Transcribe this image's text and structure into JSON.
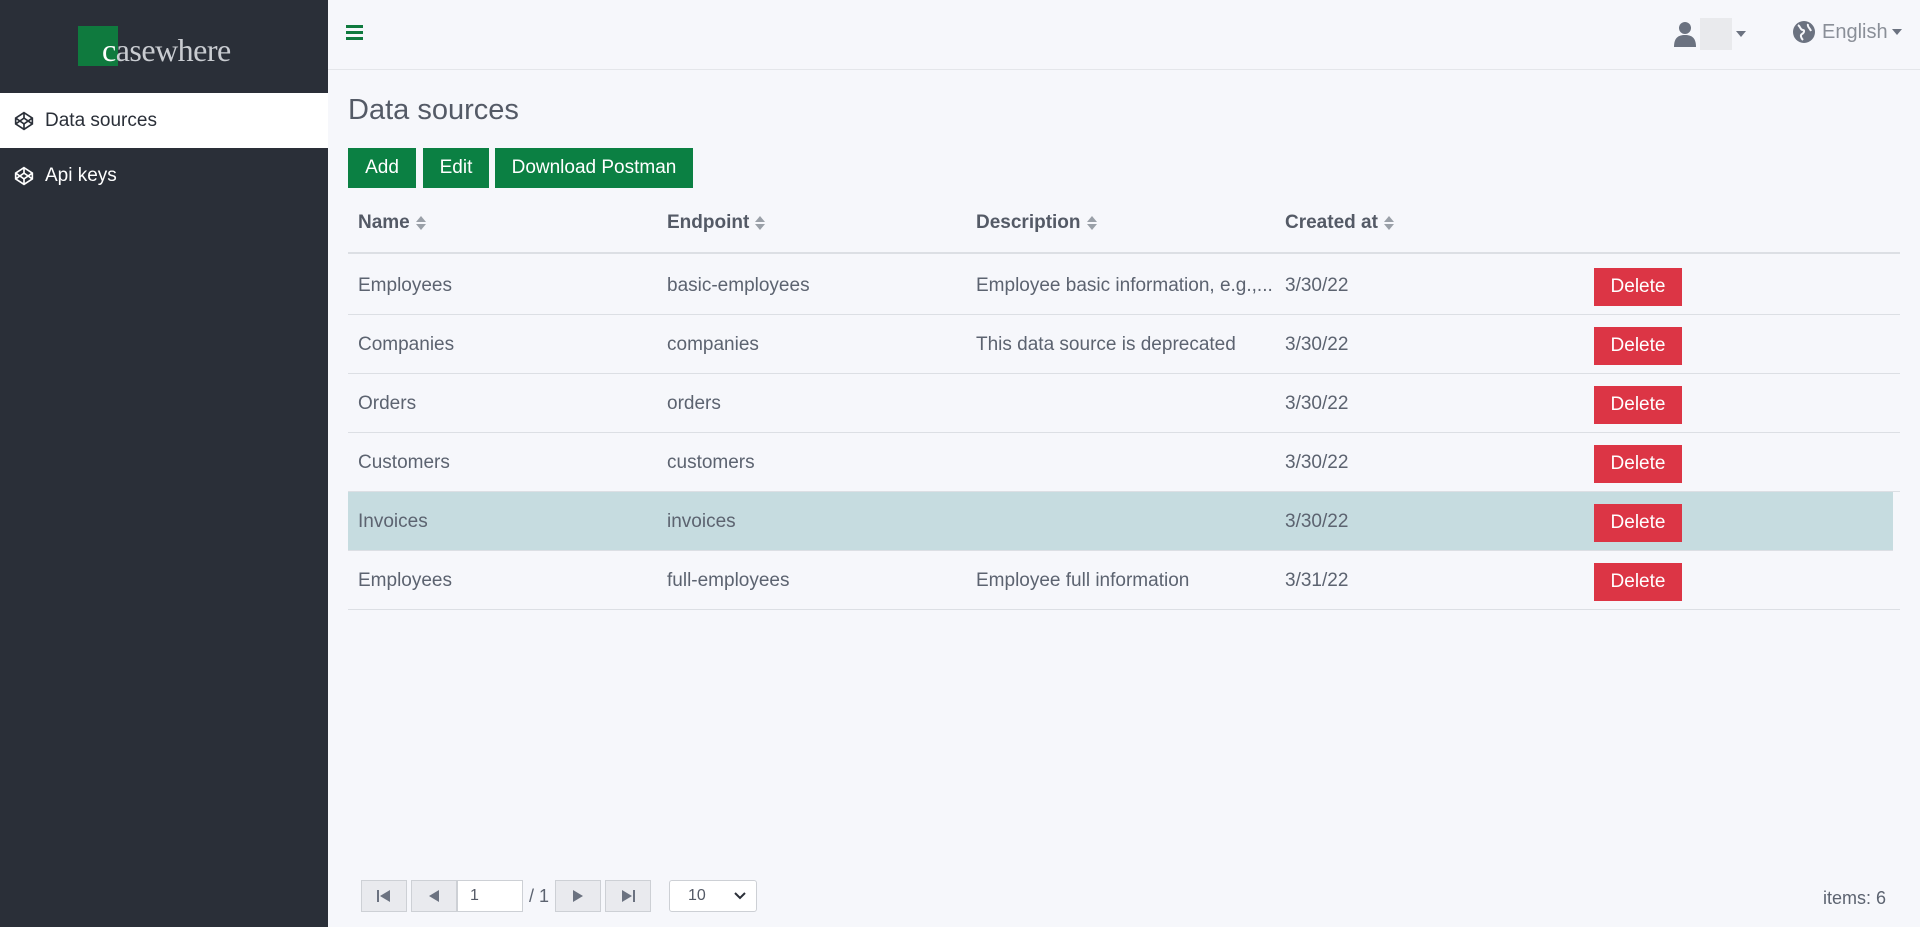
{
  "app": {
    "logo_text": "casewhere"
  },
  "sidebar": {
    "items": [
      {
        "label": "Data sources",
        "icon": "codepen-icon",
        "active": true
      },
      {
        "label": "Api keys",
        "icon": "codepen-icon",
        "active": false
      }
    ]
  },
  "topbar": {
    "menu_icon": "hamburger-icon",
    "user_icon": "user-icon",
    "language": "English",
    "language_icon": "globe-icon"
  },
  "page": {
    "title": "Data sources"
  },
  "toolbar": {
    "add_label": "Add",
    "edit_label": "Edit",
    "download_label": "Download Postman"
  },
  "table": {
    "columns": [
      "Name",
      "Endpoint",
      "Description",
      "Created at"
    ],
    "delete_label": "Delete",
    "rows": [
      {
        "name": "Employees",
        "endpoint": "basic-employees",
        "description": "Employee basic information, e.g.,...",
        "created": "3/30/22",
        "selected": false
      },
      {
        "name": "Companies",
        "endpoint": "companies",
        "description": "This data source is deprecated",
        "created": "3/30/22",
        "selected": false
      },
      {
        "name": "Orders",
        "endpoint": "orders",
        "description": "",
        "created": "3/30/22",
        "selected": false
      },
      {
        "name": "Customers",
        "endpoint": "customers",
        "description": "",
        "created": "3/30/22",
        "selected": false
      },
      {
        "name": "Invoices",
        "endpoint": "invoices",
        "description": "",
        "created": "3/30/22",
        "selected": true
      },
      {
        "name": "Employees",
        "endpoint": "full-employees",
        "description": "Employee full information",
        "created": "3/31/22",
        "selected": false
      }
    ]
  },
  "pager": {
    "current_page": "1",
    "of_pages": "/ 1",
    "page_size": "10",
    "items_text": "items: 6"
  },
  "colors": {
    "brand_green": "#0b8043",
    "danger": "#dc3545",
    "sidebar_bg": "#2a2f38",
    "selected_row": "#c6dce0"
  }
}
